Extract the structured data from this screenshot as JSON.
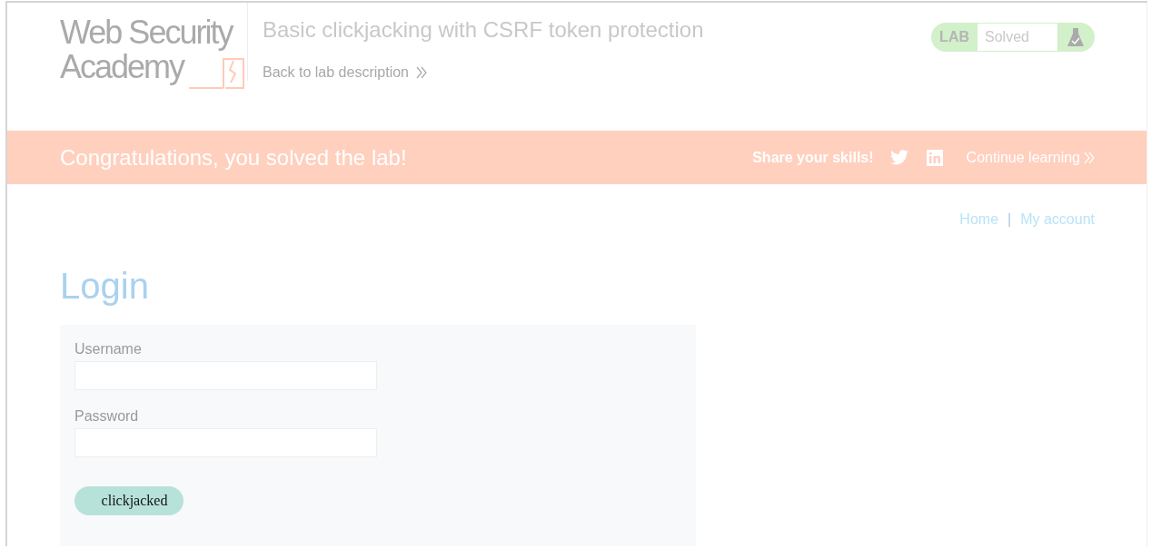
{
  "header": {
    "logo_lines": [
      "Web Security",
      "Academy"
    ],
    "title": "Basic clickjacking with CSRF token protection",
    "back_link": "Back to lab description",
    "lab_status": {
      "label": "LAB",
      "status": "Solved"
    }
  },
  "banner": {
    "message": "Congratulations, you solved the lab!",
    "share_label": "Share your skills!",
    "continue_link": "Continue learning"
  },
  "nav": {
    "links": [
      "Home",
      "My account"
    ],
    "separator": "|"
  },
  "login": {
    "heading": "Login",
    "fields": [
      {
        "label": "Username"
      },
      {
        "label": "Password"
      }
    ],
    "button": "clickjacked"
  }
}
